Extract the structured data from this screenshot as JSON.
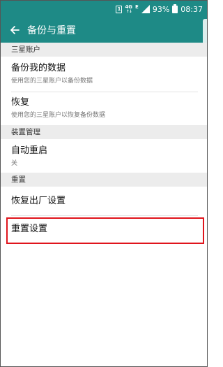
{
  "status_bar": {
    "sim_label": "1",
    "network_label": "4G",
    "network_arrows": "↑↓",
    "data_label": "E",
    "battery_percent": "93%",
    "time": "08:37"
  },
  "app_bar": {
    "title": "备份与重置",
    "background": "#1e8a86"
  },
  "sections": {
    "account": {
      "header": "三星账户",
      "items": [
        {
          "title": "备份我的数据",
          "subtitle": "使用您的三星账户以备份数据"
        },
        {
          "title": "恢复",
          "subtitle": "使用您的三星账户以恢复备份数据"
        }
      ]
    },
    "device": {
      "header": "装置管理",
      "items": [
        {
          "title": "自动重启",
          "subtitle": "关"
        }
      ]
    },
    "reset": {
      "header": "重置",
      "items": [
        {
          "title": "恢复出厂设置"
        },
        {
          "title": "重置设置"
        }
      ]
    }
  },
  "highlight_color": "#e0141c"
}
